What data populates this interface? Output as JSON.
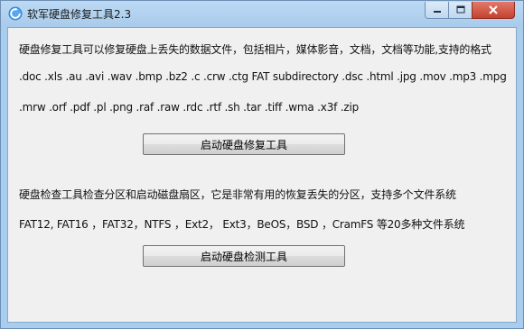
{
  "window": {
    "title": "软军硬盘修复工具2.3",
    "close_color": "#c5412e",
    "icon": "app-refresh-icon"
  },
  "controls": {
    "minimize_icon": "minimize-icon",
    "maximize_icon": "maximize-icon",
    "close_icon": "close-icon"
  },
  "repair_section": {
    "description": "硬盘修复工具可以修复硬盘上丢失的数据文件，包括相片，媒体影音，文档，文档等功能,支持的格式",
    "formats_line1": ".doc .xls .au .avi .wav .bmp .bz2 .c .crw .ctg FAT subdirectory .dsc .html .jpg .mov .mp3 .mpg",
    "formats_line2": ".mrw .orf .pdf .pl .png .raf .raw .rdc .rtf .sh .tar .tiff .wma .x3f .zip",
    "button_label": "启动硬盘修复工具"
  },
  "check_section": {
    "description": "硬盘检查工具检查分区和启动磁盘扇区，它是非常有用的恢复丢失的分区，支持多个文件系统",
    "filesystems": "FAT12, FAT16 ，FAT32，NTFS ，Ext2， Ext3，BeOS，BSD ，CramFS 等20多种文件系统",
    "button_label": "启动硬盘检测工具"
  }
}
